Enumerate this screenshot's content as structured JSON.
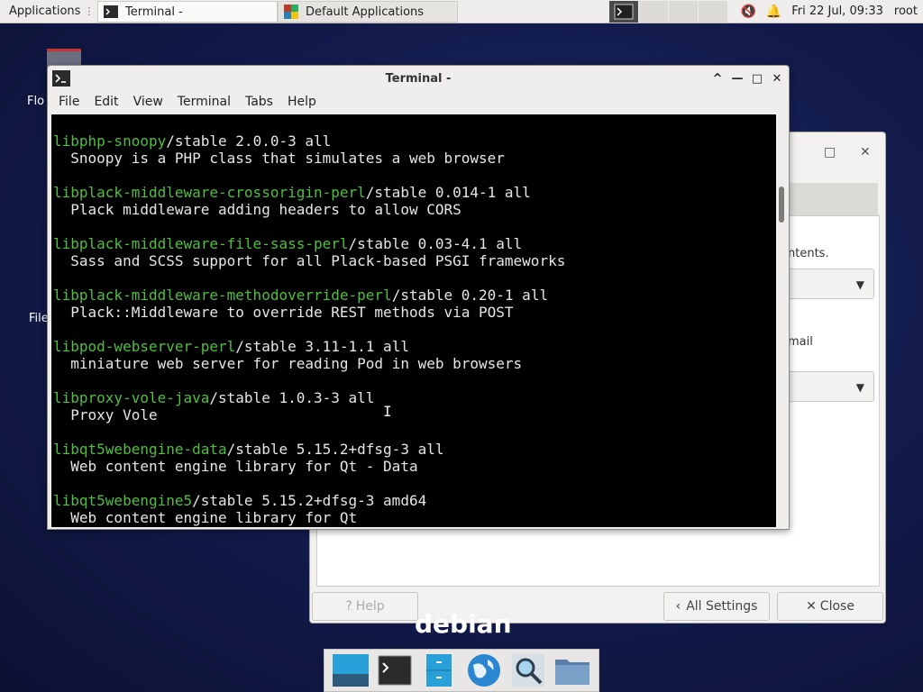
{
  "top_panel": {
    "applications_label": "Applications",
    "tasks": [
      {
        "label": "Terminal -",
        "active": true
      },
      {
        "label": "Default Applications",
        "active": false
      }
    ],
    "clock": "Fri 22 Jul, 09:33",
    "user": "root"
  },
  "desktop": {
    "icon_labels": [
      "Flo",
      "File"
    ]
  },
  "bg_dialog": {
    "text_contents": "ntents.",
    "text_mail": "mail",
    "help_label": "Help",
    "all_settings_label": "All Settings",
    "close_label": "Close"
  },
  "debian_label": "debian",
  "terminal": {
    "title": "Terminal -",
    "menu": [
      "File",
      "Edit",
      "View",
      "Terminal",
      "Tabs",
      "Help"
    ],
    "lines": [
      {
        "pkg": "libphp-snoopy",
        "rest": "/stable 2.0.0-3 all"
      },
      {
        "pkg": "",
        "rest": "  Snoopy is a PHP class that simulates a web browser"
      },
      {
        "pkg": "",
        "rest": ""
      },
      {
        "pkg": "libplack-middleware-crossorigin-perl",
        "rest": "/stable 0.014-1 all"
      },
      {
        "pkg": "",
        "rest": "  Plack middleware adding headers to allow CORS"
      },
      {
        "pkg": "",
        "rest": ""
      },
      {
        "pkg": "libplack-middleware-file-sass-perl",
        "rest": "/stable 0.03-4.1 all"
      },
      {
        "pkg": "",
        "rest": "  Sass and SCSS support for all Plack-based PSGI frameworks"
      },
      {
        "pkg": "",
        "rest": ""
      },
      {
        "pkg": "libplack-middleware-methodoverride-perl",
        "rest": "/stable 0.20-1 all"
      },
      {
        "pkg": "",
        "rest": "  Plack::Middleware to override REST methods via POST"
      },
      {
        "pkg": "",
        "rest": ""
      },
      {
        "pkg": "libpod-webserver-perl",
        "rest": "/stable 3.11-1.1 all"
      },
      {
        "pkg": "",
        "rest": "  miniature web server for reading Pod in web browsers"
      },
      {
        "pkg": "",
        "rest": ""
      },
      {
        "pkg": "libproxy-vole-java",
        "rest": "/stable 1.0.3-3 all"
      },
      {
        "pkg": "",
        "rest": "  Proxy Vole"
      },
      {
        "pkg": "",
        "rest": ""
      },
      {
        "pkg": "libqt5webengine-data",
        "rest": "/stable 5.15.2+dfsg-3 all"
      },
      {
        "pkg": "",
        "rest": "  Web content engine library for Qt - Data"
      },
      {
        "pkg": "",
        "rest": ""
      },
      {
        "pkg": "libqt5webengine5",
        "rest": "/stable 5.15.2+dfsg-3 amd64"
      },
      {
        "pkg": "",
        "rest": "  Web content engine library for Qt"
      }
    ]
  },
  "colors": {
    "pkg_green": "#4fbf3d",
    "terminal_bg": "#000000",
    "terminal_fg": "#e6e6e6"
  }
}
